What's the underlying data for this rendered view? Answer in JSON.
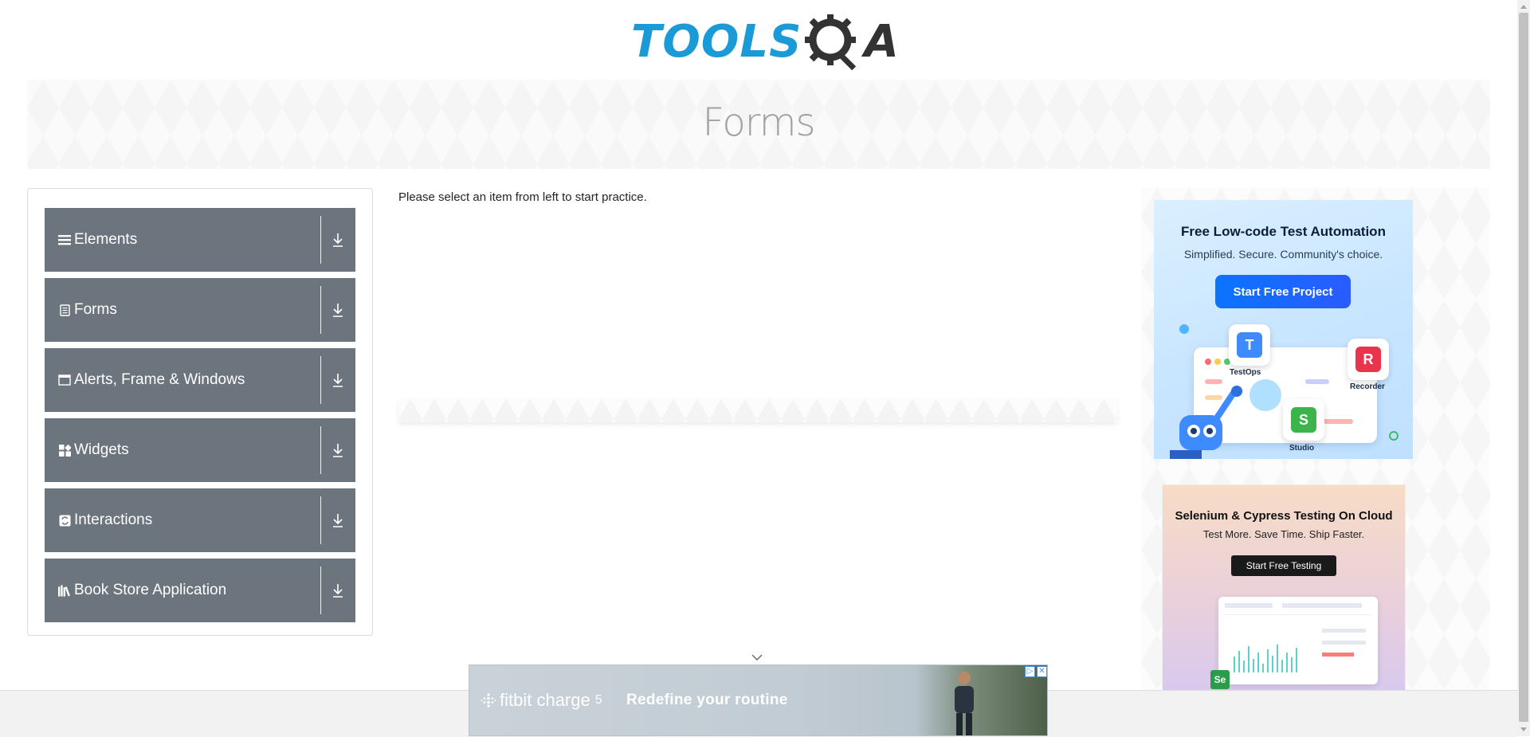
{
  "header": {
    "logo_text": "TOOLS",
    "logo_suffix": "A"
  },
  "banner": {
    "title": "Forms"
  },
  "sidebar": {
    "items": [
      {
        "label": "Elements",
        "icon": "list-icon"
      },
      {
        "label": "Forms",
        "icon": "form-icon"
      },
      {
        "label": "Alerts, Frame & Windows",
        "icon": "window-icon"
      },
      {
        "label": "Widgets",
        "icon": "widgets-icon"
      },
      {
        "label": "Interactions",
        "icon": "interactions-icon"
      },
      {
        "label": "Book Store Application",
        "icon": "books-icon"
      }
    ]
  },
  "main": {
    "message": "Please select an item from left to start practice."
  },
  "ads": {
    "katalon": {
      "title": "Free Low-code Test Automation",
      "subtitle": "Simplified. Secure. Community's choice.",
      "cta": "Start Free Project",
      "tiles": [
        "TestOps",
        "Recorder",
        "Studio"
      ],
      "tile_letters": [
        "T",
        "R",
        "S"
      ]
    },
    "lambdatest": {
      "title": "Selenium & Cypress Testing On Cloud",
      "subtitle": "Test More. Save Time. Ship Faster.",
      "cta": "Start Free Testing",
      "badge": "Se"
    },
    "fitbit": {
      "brand": "fitbit charge",
      "model": "5",
      "slogan": "Redefine your routine"
    }
  },
  "colors": {
    "sidebar_item_bg": "#6c757d",
    "logo_blue": "#1a9ad6",
    "cta_blue": "#0b74ff"
  }
}
